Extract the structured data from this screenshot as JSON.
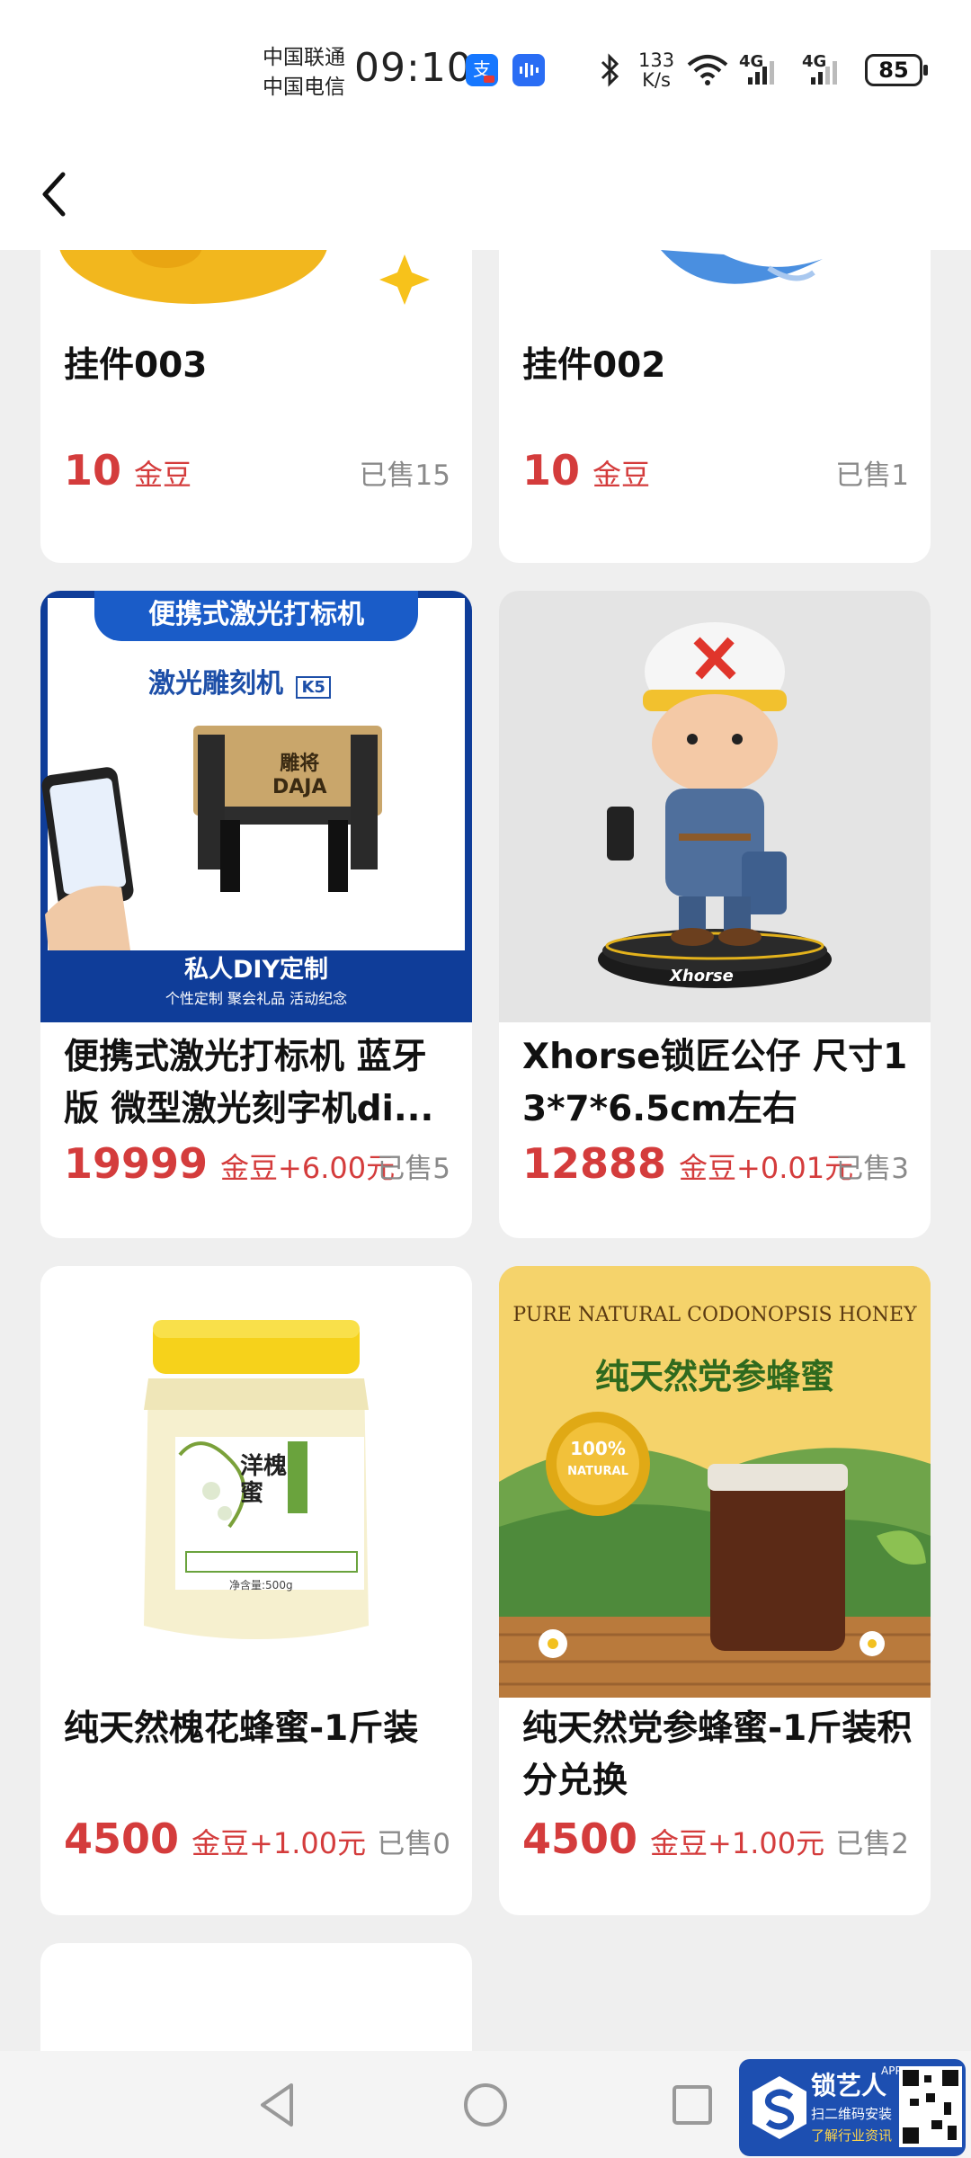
{
  "status_bar": {
    "carrier_1": "中国联通",
    "carrier_2": "中国电信",
    "time": "09:10",
    "net_speed_value": "133",
    "net_speed_unit": "K/s",
    "signal_1": "4G",
    "signal_2": "4G",
    "battery": "85"
  },
  "header": {
    "back_icon": "chevron-left-icon"
  },
  "products": [
    {
      "title": "挂件003",
      "price": "10",
      "unit": "金豆",
      "sold": "已售15"
    },
    {
      "title": "挂件002",
      "price": "10",
      "unit": "金豆",
      "sold": "已售1"
    },
    {
      "title": "便携式激光打标机 蓝牙版 微型激光刻字机di...",
      "price": "19999",
      "unit": "金豆+6.00元",
      "sold": "已售5",
      "image_text": {
        "banner": "便携式激光打标机",
        "name": "激光雕刻机",
        "model": "K5",
        "brand_cn": "雕将",
        "brand_en": "DAJA",
        "footer": "私人DIY定制",
        "tags": "个性定制   聚会礼品   活动纪念"
      }
    },
    {
      "title": "Xhorse锁匠公仔 尺寸13*7*6.5cm左右",
      "price": "12888",
      "unit": "金豆+0.01元",
      "sold": "已售3",
      "image_text": {
        "base_logo": "Xhorse"
      }
    },
    {
      "title": "纯天然槐花蜂蜜-1斤装",
      "price": "4500",
      "unit": "金豆+1.00元",
      "sold": "已售0",
      "image_text": {
        "label": "洋槐蜜",
        "net": "净含量:500g"
      }
    },
    {
      "title": "纯天然党参蜂蜜-1斤装积分兑换",
      "price": "4500",
      "unit": "金豆+1.00元",
      "sold": "已售2",
      "image_text": {
        "headline_en": "PURE NATURAL CODONOPSIS HONEY",
        "headline_cn": "纯天然党参蜂蜜",
        "seal_pct": "100%",
        "seal_word": "NATURAL"
      }
    }
  ],
  "nav": {
    "back": "nav-back-icon",
    "home": "nav-home-icon",
    "recent": "nav-recent-icon"
  },
  "watermark": {
    "brand": "锁艺人",
    "app_tag": "APP",
    "line1": "扫二维码安装",
    "line2": "了解行业资讯"
  },
  "colors": {
    "price_red": "#d43c3c",
    "page_bg": "#efefef",
    "muted": "#8a8a8a"
  }
}
